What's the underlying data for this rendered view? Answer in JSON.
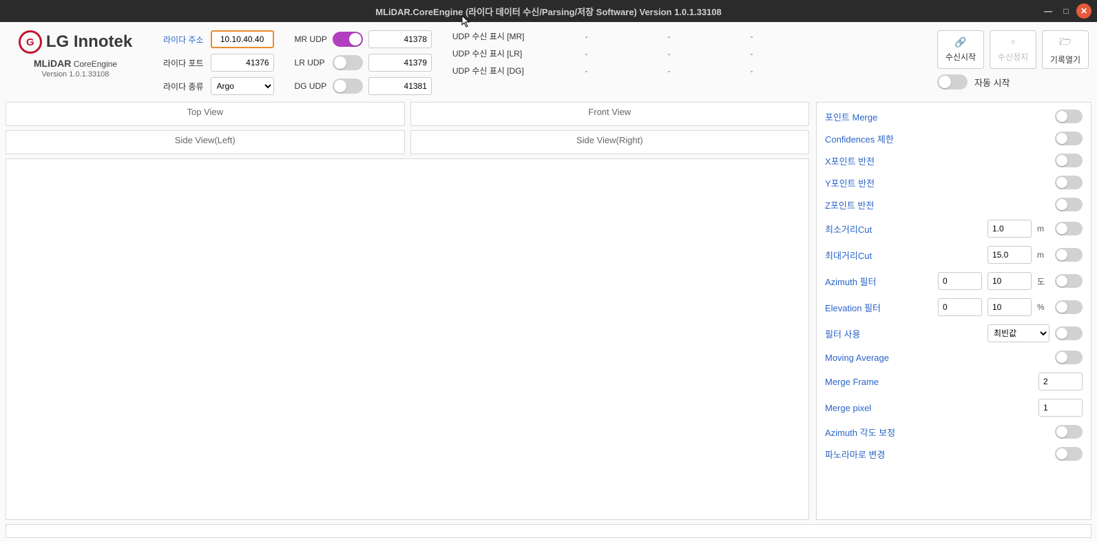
{
  "window": {
    "title": "MLiDAR.CoreEngine (라이다 데이터 수신/Parsing/저장 Software) Version 1.0.1.33108"
  },
  "brand": {
    "company": "LG Innotek",
    "product": "MLiDAR",
    "product_sub": "CoreEngine",
    "version": "Version 1.0.1.33108"
  },
  "config": {
    "addr_label": "라이다 주소",
    "addr_value": "10.10.40.40",
    "port_label": "라이다 포트",
    "port_value": "41376",
    "type_label": "라이다 종류",
    "type_value": "Argo"
  },
  "udp": {
    "mr_label": "MR UDP",
    "mr_on": true,
    "mr_port": "41378",
    "lr_label": "LR UDP",
    "lr_on": false,
    "lr_port": "41379",
    "dg_label": "DG UDP",
    "dg_on": false,
    "dg_port": "41381"
  },
  "disp": {
    "mr_label": "UDP 수신 표시 [MR]",
    "mr_v1": "-",
    "mr_v2": "-",
    "mr_v3": "-",
    "lr_label": "UDP 수신 표시 [LR]",
    "lr_v1": "-",
    "lr_v2": "-",
    "lr_v3": "-",
    "dg_label": "UDP 수신 표시 [DG]",
    "dg_v1": "-",
    "dg_v2": "-",
    "dg_v3": "-"
  },
  "actions": {
    "start": "수신시작",
    "stop": "수신정지",
    "open": "기록열기",
    "auto": "자동 시작"
  },
  "views": {
    "top": "Top View",
    "front": "Front View",
    "left": "Side View(Left)",
    "right": "Side View(Right)"
  },
  "opts": {
    "merge": "포인트 Merge",
    "conf": "Confidences 제한",
    "xflip": "X포인트 반전",
    "yflip": "Y포인트 반전",
    "zflip": "Z포인트 반전",
    "mincut": "최소거리Cut",
    "mincut_v": "1.0",
    "mincut_u": "m",
    "maxcut": "최대거리Cut",
    "maxcut_v": "15.0",
    "maxcut_u": "m",
    "az": "Azimuth 필터",
    "az_a": "0",
    "az_b": "10",
    "az_u": "도",
    "el": "Elevation 필터",
    "el_a": "0",
    "el_b": "10",
    "el_u": "%",
    "fuse": "필터 사용",
    "fuse_v": "최빈값",
    "mavg": "Moving Average",
    "mframe": "Merge Frame",
    "mframe_v": "2",
    "mpixel": "Merge pixel",
    "mpixel_v": "1",
    "azcorr": "Azimuth 각도 보정",
    "pano": "파노라마로 변경"
  }
}
